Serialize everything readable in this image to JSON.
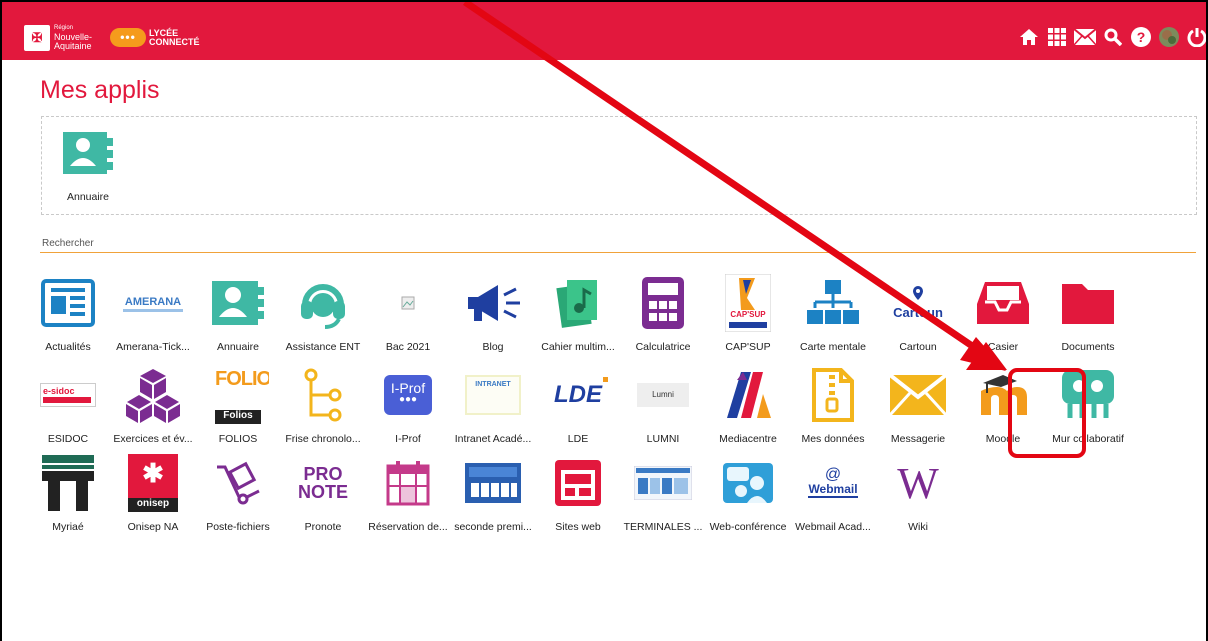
{
  "header": {
    "region_line1": "Région",
    "region_line2": "Nouvelle-",
    "region_line3": "Aquitaine",
    "lycee_line1": "LYCÉE",
    "lycee_line2": "CONNECTÉ",
    "icons": [
      "home-icon",
      "apps-grid-icon",
      "mail-icon",
      "search-icon",
      "help-icon",
      "avatar",
      "power-icon"
    ]
  },
  "page": {
    "title": "Mes applis"
  },
  "favorites": [
    {
      "label": "Annuaire"
    }
  ],
  "search": {
    "placeholder": "Rechercher"
  },
  "apps": [
    {
      "label": "Actualités"
    },
    {
      "label": "Amerana-Tick..."
    },
    {
      "label": "Annuaire"
    },
    {
      "label": "Assistance ENT"
    },
    {
      "label": "Bac 2021"
    },
    {
      "label": "Blog"
    },
    {
      "label": "Cahier multim..."
    },
    {
      "label": "Calculatrice"
    },
    {
      "label": "CAP'SUP"
    },
    {
      "label": "Carte mentale"
    },
    {
      "label": "Cartoun"
    },
    {
      "label": "Casier"
    },
    {
      "label": "Documents"
    },
    {
      "label": "ESIDOC"
    },
    {
      "label": "Exercices et év..."
    },
    {
      "label": "FOLIOS"
    },
    {
      "label": "Frise chronolo..."
    },
    {
      "label": "I-Prof"
    },
    {
      "label": "Intranet Acadé..."
    },
    {
      "label": "LDE"
    },
    {
      "label": "LUMNI"
    },
    {
      "label": "Mediacentre"
    },
    {
      "label": "Mes données"
    },
    {
      "label": "Messagerie"
    },
    {
      "label": "Moodle"
    },
    {
      "label": "Mur collaboratif"
    },
    {
      "label": "Myriaé"
    },
    {
      "label": "Onisep NA"
    },
    {
      "label": "Poste-fichiers"
    },
    {
      "label": "Pronote"
    },
    {
      "label": "Réservation de..."
    },
    {
      "label": "seconde premi..."
    },
    {
      "label": "Sites web"
    },
    {
      "label": "TERMINALES ..."
    },
    {
      "label": "Web-conférence"
    },
    {
      "label": "Webmail Acad..."
    },
    {
      "label": "Wiki"
    }
  ],
  "icon_text": {
    "amerana": "AMERANA",
    "iprof": "I-Prof",
    "lde": "LDE",
    "lumni": "Lumni",
    "folio": "FOLIO",
    "folios_bar": "Folios",
    "capsup": "CAP'SUP",
    "cartoun": "Cartoun",
    "esidoc": "e-sidoc",
    "onisep": "onisep",
    "pronote1": "PRO",
    "pronote2": "NOTE",
    "webmail": "Webmail",
    "wiki": "W",
    "intranet": "INTRANET"
  },
  "colors": {
    "brand_red": "#e2183d",
    "teal": "#3fb8a4",
    "search_line": "#f0a23a",
    "annotation_red": "#e30613"
  }
}
